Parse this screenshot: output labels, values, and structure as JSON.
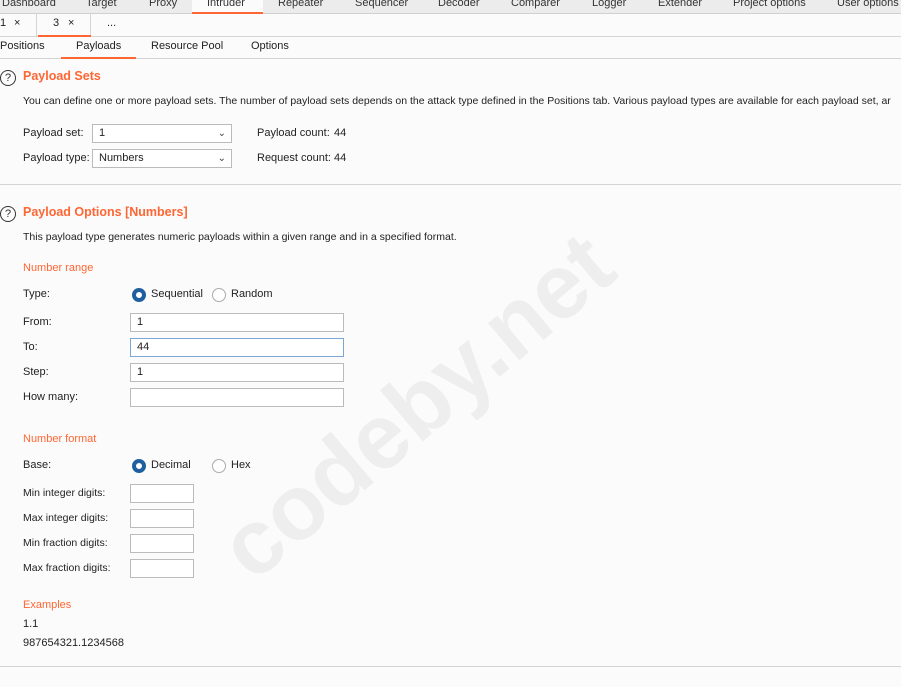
{
  "top_tabs": [
    {
      "label": "Dashboard"
    },
    {
      "label": "Target"
    },
    {
      "label": "Proxy"
    },
    {
      "label": "Intruder",
      "selected": true
    },
    {
      "label": "Repeater"
    },
    {
      "label": "Sequencer"
    },
    {
      "label": "Decoder"
    },
    {
      "label": "Comparer"
    },
    {
      "label": "Logger"
    },
    {
      "label": "Extender"
    },
    {
      "label": "Project options"
    },
    {
      "label": "User options"
    }
  ],
  "attack_tabs": [
    {
      "label": "1",
      "close": "×"
    },
    {
      "label": "3",
      "close": "×",
      "selected": true
    },
    {
      "label": "..."
    }
  ],
  "sub_tabs": [
    {
      "label": "Positions"
    },
    {
      "label": "Payloads",
      "selected": true
    },
    {
      "label": "Resource Pool"
    },
    {
      "label": "Options"
    }
  ],
  "accent": "#ff6633",
  "payload_sets": {
    "help": "?",
    "title": "Payload Sets",
    "description": "You can define one or more payload sets. The number of payload sets depends on the attack type defined in the Positions tab. Various payload types are available for each payload set, ar",
    "set_label": "Payload set:",
    "set_value": "1",
    "type_label": "Payload type:",
    "type_value": "Numbers",
    "count_label": "Payload count:",
    "count_value": "44",
    "request_label": "Request count:",
    "request_value": "44"
  },
  "payload_options": {
    "help": "?",
    "title": "Payload Options [Numbers]",
    "description": "This payload type generates numeric payloads within a given range and in a specified format.",
    "range_heading": "Number range",
    "type_label": "Type:",
    "type_options": [
      {
        "label": "Sequential",
        "checked": true
      },
      {
        "label": "Random",
        "checked": false
      }
    ],
    "from_label": "From:",
    "from_value": "1",
    "to_label": "To:",
    "to_value": "44",
    "step_label": "Step:",
    "step_value": "1",
    "howmany_label": "How many:",
    "howmany_value": "",
    "format_heading": "Number format",
    "base_label": "Base:",
    "base_options": [
      {
        "label": "Decimal",
        "checked": true
      },
      {
        "label": "Hex",
        "checked": false
      }
    ],
    "min_int_label": "Min integer digits:",
    "min_int_value": "",
    "max_int_label": "Max integer digits:",
    "max_int_value": "",
    "min_frac_label": "Min fraction digits:",
    "min_frac_value": "",
    "max_frac_label": "Max fraction digits:",
    "max_frac_value": "",
    "examples_heading": "Examples",
    "examples": [
      "1.1",
      "987654321.1234568"
    ]
  },
  "watermark": "codeby.net"
}
